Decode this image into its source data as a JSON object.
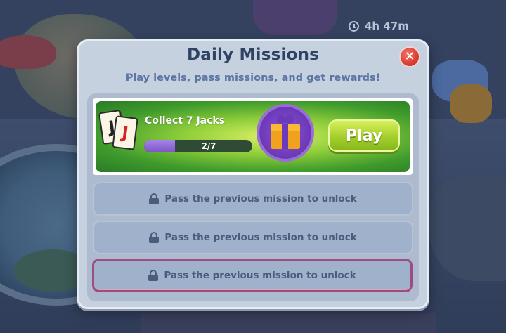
{
  "timer": {
    "text": "4h 47m",
    "icon": "clock-icon"
  },
  "dialog": {
    "title": "Daily Missions",
    "subtitle": "Play levels, pass missions, and get rewards!",
    "close_icon": "close-icon"
  },
  "active_mission": {
    "name": "Collect 7 Jacks",
    "card_letters": [
      "J",
      "J"
    ],
    "progress_current": 2,
    "progress_total": 7,
    "progress_text": "2/7",
    "reward_icon": "gift-icon",
    "play_label": "Play"
  },
  "locked_missions": [
    {
      "label": "Pass the previous mission to unlock",
      "icon": "lock-icon"
    },
    {
      "label": "Pass the previous mission to unlock",
      "icon": "lock-icon"
    },
    {
      "label": "Pass the previous mission to unlock",
      "icon": "lock-icon"
    }
  ],
  "colors": {
    "title": "#2f4265",
    "subtitle": "#5b76a4",
    "play_button": "#a3cf2b",
    "progress_fill": "#7b55c9",
    "close_button": "#d83f35"
  }
}
